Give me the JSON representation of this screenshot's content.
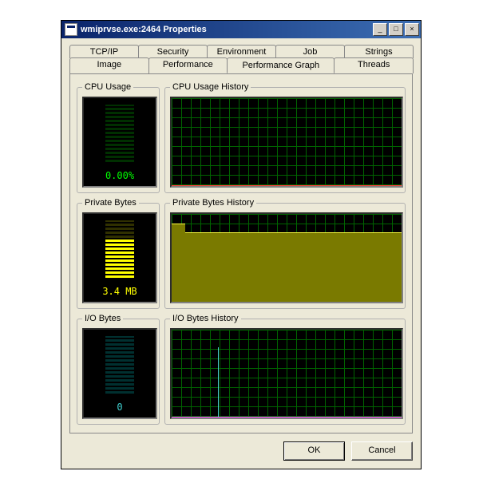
{
  "window": {
    "title": "wmiprvse.exe:2464 Properties",
    "controls": {
      "min": "_",
      "max": "□",
      "close": "×"
    }
  },
  "tabs_row1": [
    "TCP/IP",
    "Security",
    "Environment",
    "Job",
    "Strings"
  ],
  "tabs_row2": [
    "Image",
    "Performance",
    "Performance Graph",
    "Threads"
  ],
  "active_tab": "Performance Graph",
  "panels": {
    "cpu": {
      "gauge_title": "CPU Usage",
      "history_title": "CPU Usage History",
      "value": "0.00%",
      "color": "#00ff00",
      "level_pct": 0
    },
    "pbytes": {
      "gauge_title": "Private Bytes",
      "history_title": "Private Bytes History",
      "value": "3.4 MB",
      "color": "#ffff00",
      "level_pct": 70,
      "area_height_pct": 78,
      "step_left_pct": 6,
      "step_drop_pct": 88
    },
    "io": {
      "gauge_title": "I/O Bytes",
      "history_title": "I/O Bytes History",
      "value": "0",
      "color": "#40d0d0",
      "level_pct": 0,
      "spike_left_pct": 20,
      "spike_height_pct": 80
    }
  },
  "buttons": {
    "ok": "OK",
    "cancel": "Cancel"
  },
  "chart_data": {
    "type": "area",
    "title": "Process Performance",
    "series": [
      {
        "name": "CPU Usage %",
        "values_approx": "flat at 0%",
        "color": "#00ff00"
      },
      {
        "name": "Private Bytes",
        "values_approx": "~3.6MB dropping to 3.4MB near start then flat",
        "color": "#ffff00"
      },
      {
        "name": "I/O Bytes",
        "values_approx": "single spike early then flat at 0",
        "color": "#40d0d0"
      }
    ],
    "ylim": [
      0,
      100
    ]
  }
}
